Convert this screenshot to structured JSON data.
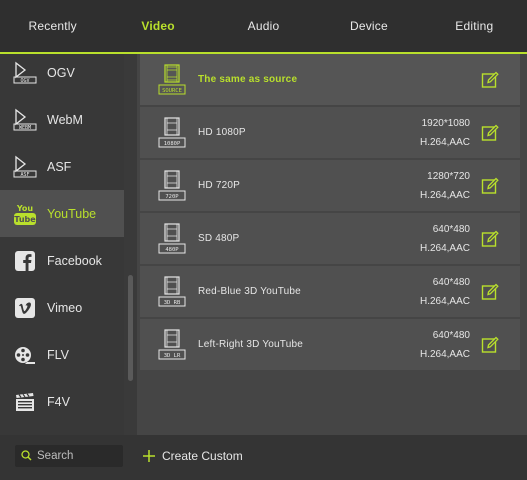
{
  "tabs": [
    {
      "label": "Recently",
      "active": false
    },
    {
      "label": "Video",
      "active": true
    },
    {
      "label": "Audio",
      "active": false
    },
    {
      "label": "Device",
      "active": false
    },
    {
      "label": "Editing",
      "active": false
    }
  ],
  "sidebar": {
    "items": [
      {
        "label": "OGV",
        "icon": "ogv-file-icon",
        "icon_text": "OGV"
      },
      {
        "label": "WebM",
        "icon": "webm-file-icon",
        "icon_text": "WEBM"
      },
      {
        "label": "ASF",
        "icon": "asf-file-icon",
        "icon_text": "ASF"
      },
      {
        "label": "YouTube",
        "icon": "youtube-icon",
        "active": true
      },
      {
        "label": "Facebook",
        "icon": "facebook-icon"
      },
      {
        "label": "Vimeo",
        "icon": "vimeo-icon"
      },
      {
        "label": "FLV",
        "icon": "flv-reel-icon"
      },
      {
        "label": "F4V",
        "icon": "f4v-clapper-icon"
      }
    ]
  },
  "presets": [
    {
      "name": "The same as source",
      "badge": "SOURCE",
      "resolution": "",
      "codec": "",
      "selected": true
    },
    {
      "name": "HD 1080P",
      "badge": "1080P",
      "resolution": "1920*1080",
      "codec": "H.264,AAC"
    },
    {
      "name": "HD 720P",
      "badge": "720P",
      "resolution": "1280*720",
      "codec": "H.264,AAC"
    },
    {
      "name": "SD 480P",
      "badge": "480P",
      "resolution": "640*480",
      "codec": "H.264,AAC"
    },
    {
      "name": "Red-Blue 3D YouTube",
      "badge": "3D RB",
      "resolution": "640*480",
      "codec": "H.264,AAC"
    },
    {
      "name": "Left-Right 3D YouTube",
      "badge": "3D LR",
      "resolution": "640*480",
      "codec": "H.264,AAC"
    }
  ],
  "bottom": {
    "search_placeholder": "Search",
    "create_label": "Create Custom"
  },
  "colors": {
    "accent": "#b9e02c",
    "background": "#3c3c3c",
    "row": "#505050"
  }
}
